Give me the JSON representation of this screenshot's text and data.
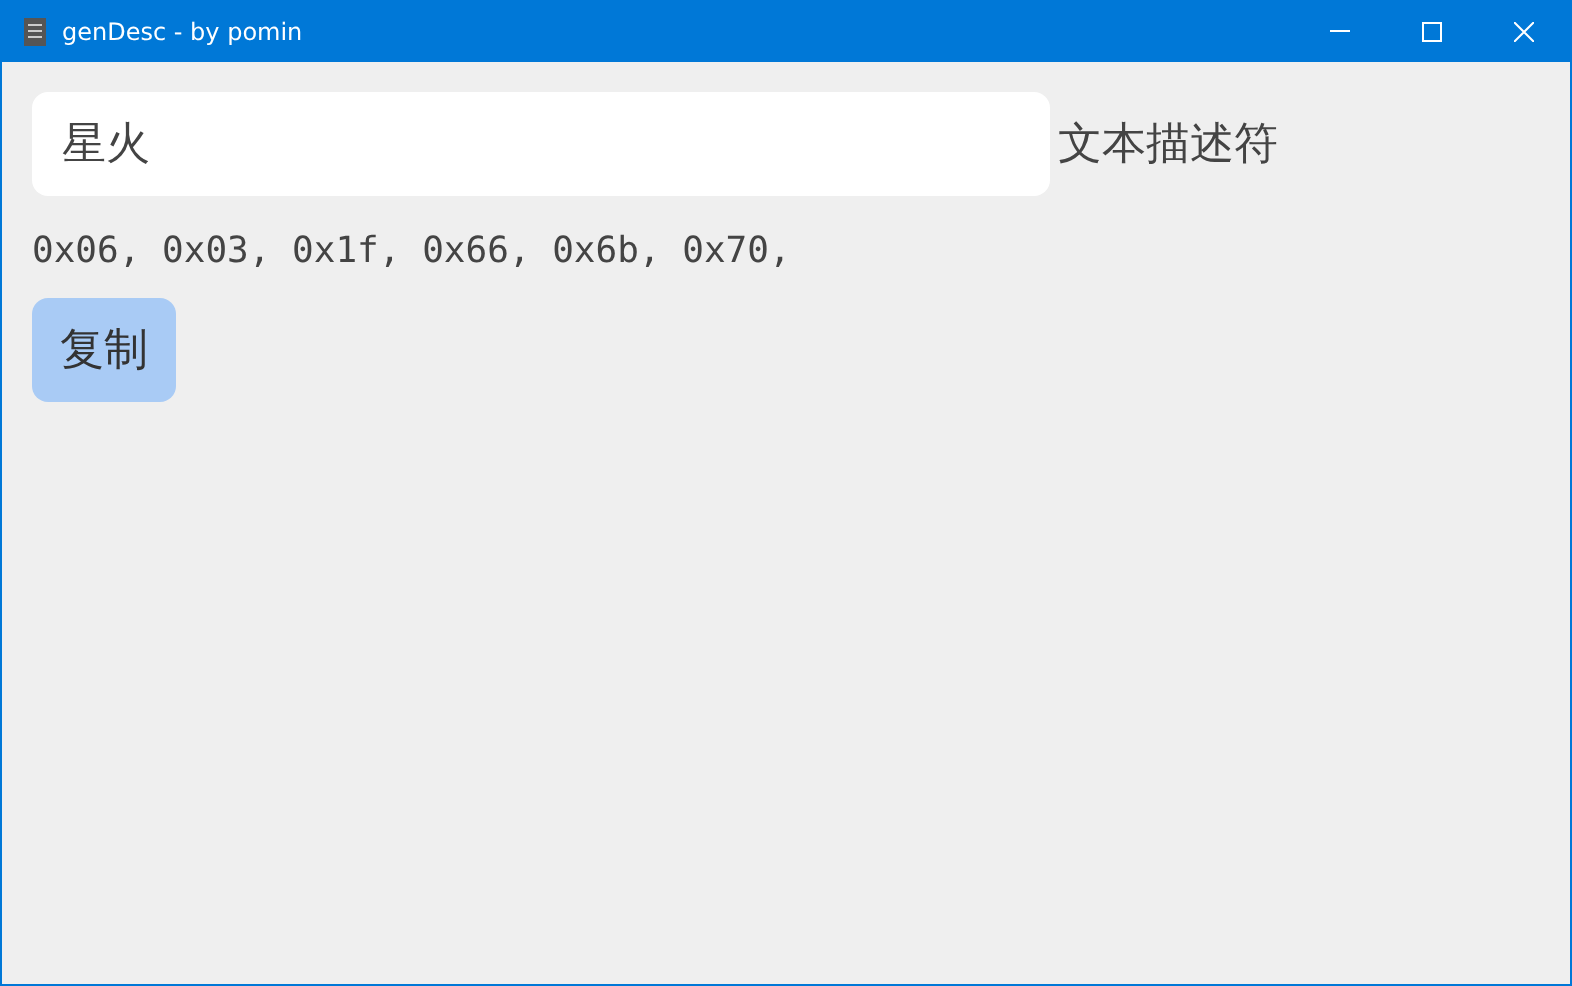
{
  "window": {
    "title": "genDesc - by pomin"
  },
  "input": {
    "value": "星火"
  },
  "label": "文本描述符",
  "output": "0x06, 0x03, 0x1f, 0x66, 0x6b, 0x70,",
  "buttons": [
    "复制"
  ]
}
